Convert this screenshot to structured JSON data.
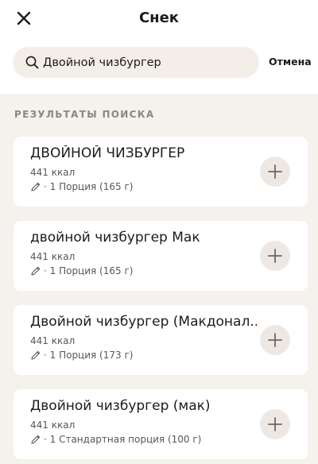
{
  "header": {
    "title": "Снек"
  },
  "search": {
    "value": "Двойной чизбургер",
    "cancel_label": "Отмена"
  },
  "results": {
    "section_label": "РЕЗУЛЬТАТЫ ПОИСКА",
    "items": [
      {
        "name": "ДВОЙНОЙ ЧИЗБУРГЕР",
        "kcal": "441 ккал",
        "portion": "· 1 Порция (165 г)"
      },
      {
        "name": "двойной чизбургер Мак",
        "kcal": "441 ккал",
        "portion": "· 1 Порция (165 г)"
      },
      {
        "name": "Двойной чизбургер (Макдонал...",
        "kcal": "441 ккал",
        "portion": "· 1 Порция (173 г)"
      },
      {
        "name": "Двойной чизбургер (мак)",
        "kcal": "441 ккал",
        "portion": "· 1 Стандартная порция (100 г)"
      }
    ]
  },
  "icons": {
    "close": "close-icon",
    "search": "search-icon",
    "edit": "pencil-icon",
    "add": "plus-icon"
  },
  "colors": {
    "background": "#f5f1ec",
    "card": "#ffffff",
    "search_field": "#f3eee8",
    "add_button": "#ede8e3",
    "section_label": "#8d8781"
  }
}
